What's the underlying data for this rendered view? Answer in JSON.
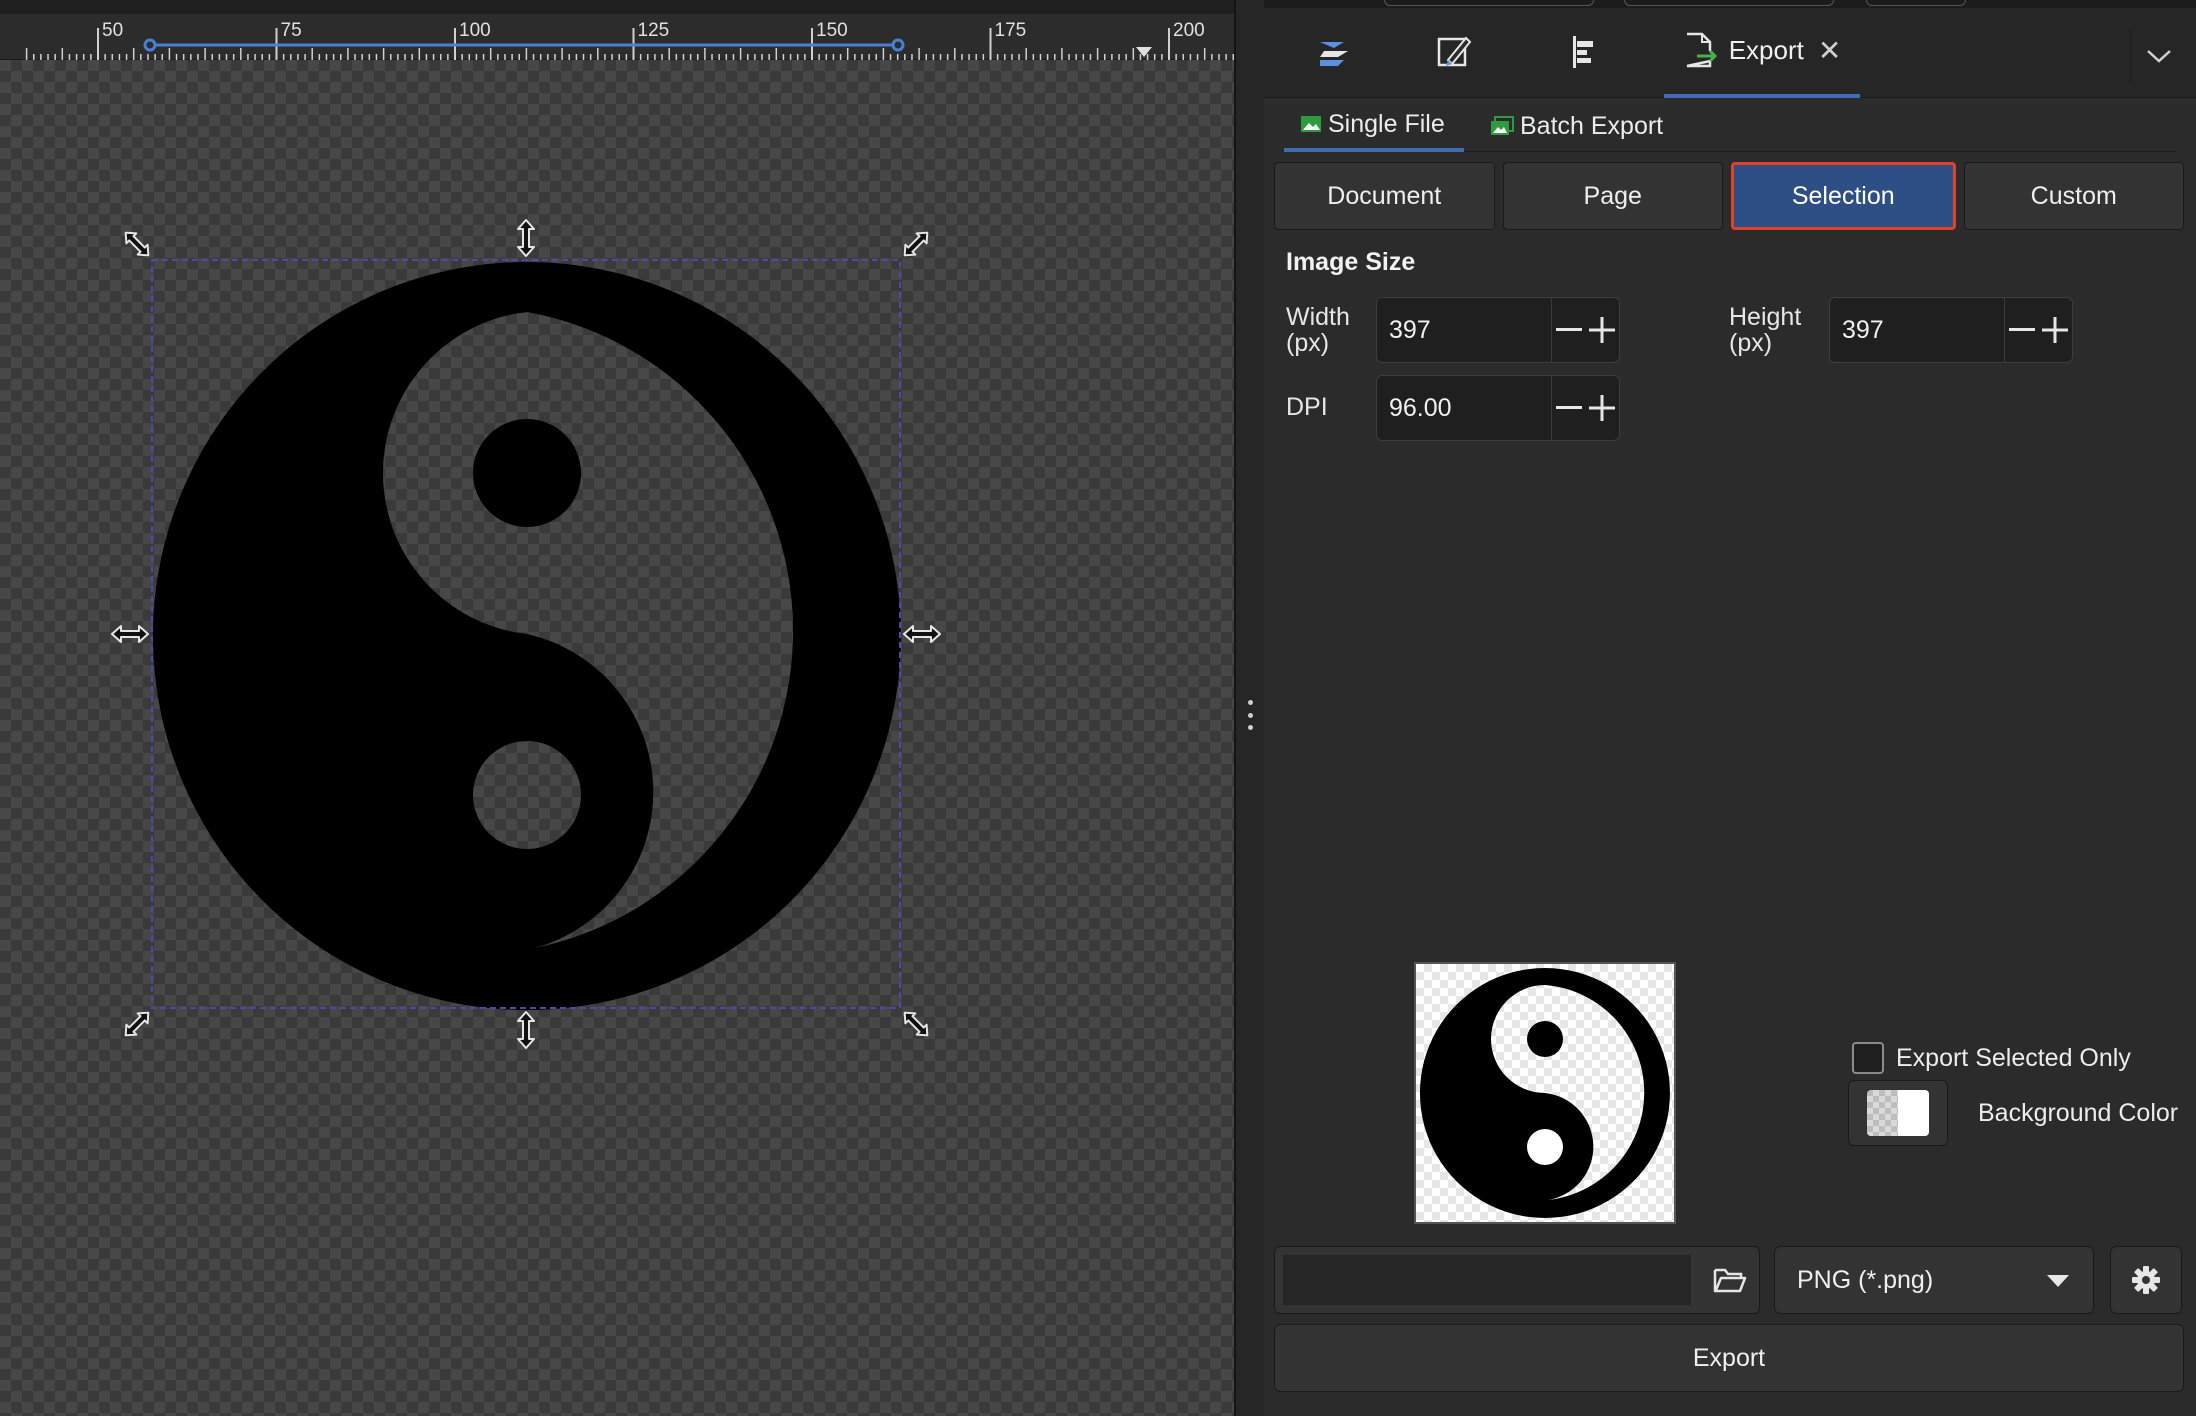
{
  "ruler": {
    "labels": [
      "50",
      "75",
      "100",
      "125",
      "150",
      "175",
      "200"
    ]
  },
  "dock": {
    "tabs": [
      {
        "icon": "layers-icon"
      },
      {
        "icon": "fill-stroke-icon"
      },
      {
        "icon": "align-icon"
      }
    ],
    "active_tab_label": "Export",
    "close_glyph": "✕"
  },
  "export": {
    "subtabs": {
      "single": "Single File",
      "batch": "Batch Export"
    },
    "areas": [
      "Document",
      "Page",
      "Selection",
      "Custom"
    ],
    "active_area": "Selection",
    "image_size_title": "Image Size",
    "width_label_1": "Width",
    "width_label_2": "(px)",
    "width_value": "397",
    "height_label_1": "Height",
    "height_label_2": "(px)",
    "height_value": "397",
    "dpi_label": "DPI",
    "dpi_value": "96.00",
    "selected_only_label": "Export Selected Only",
    "background_color_label": "Background Color",
    "filename_value": "",
    "format_value": "PNG (*.png)",
    "export_button": "Export"
  },
  "colors": {
    "accent": "#3f6db4",
    "active_area_bg": "#2d4f86",
    "highlight_border": "#e0412b",
    "selection_dash": "#4a4aa8"
  }
}
